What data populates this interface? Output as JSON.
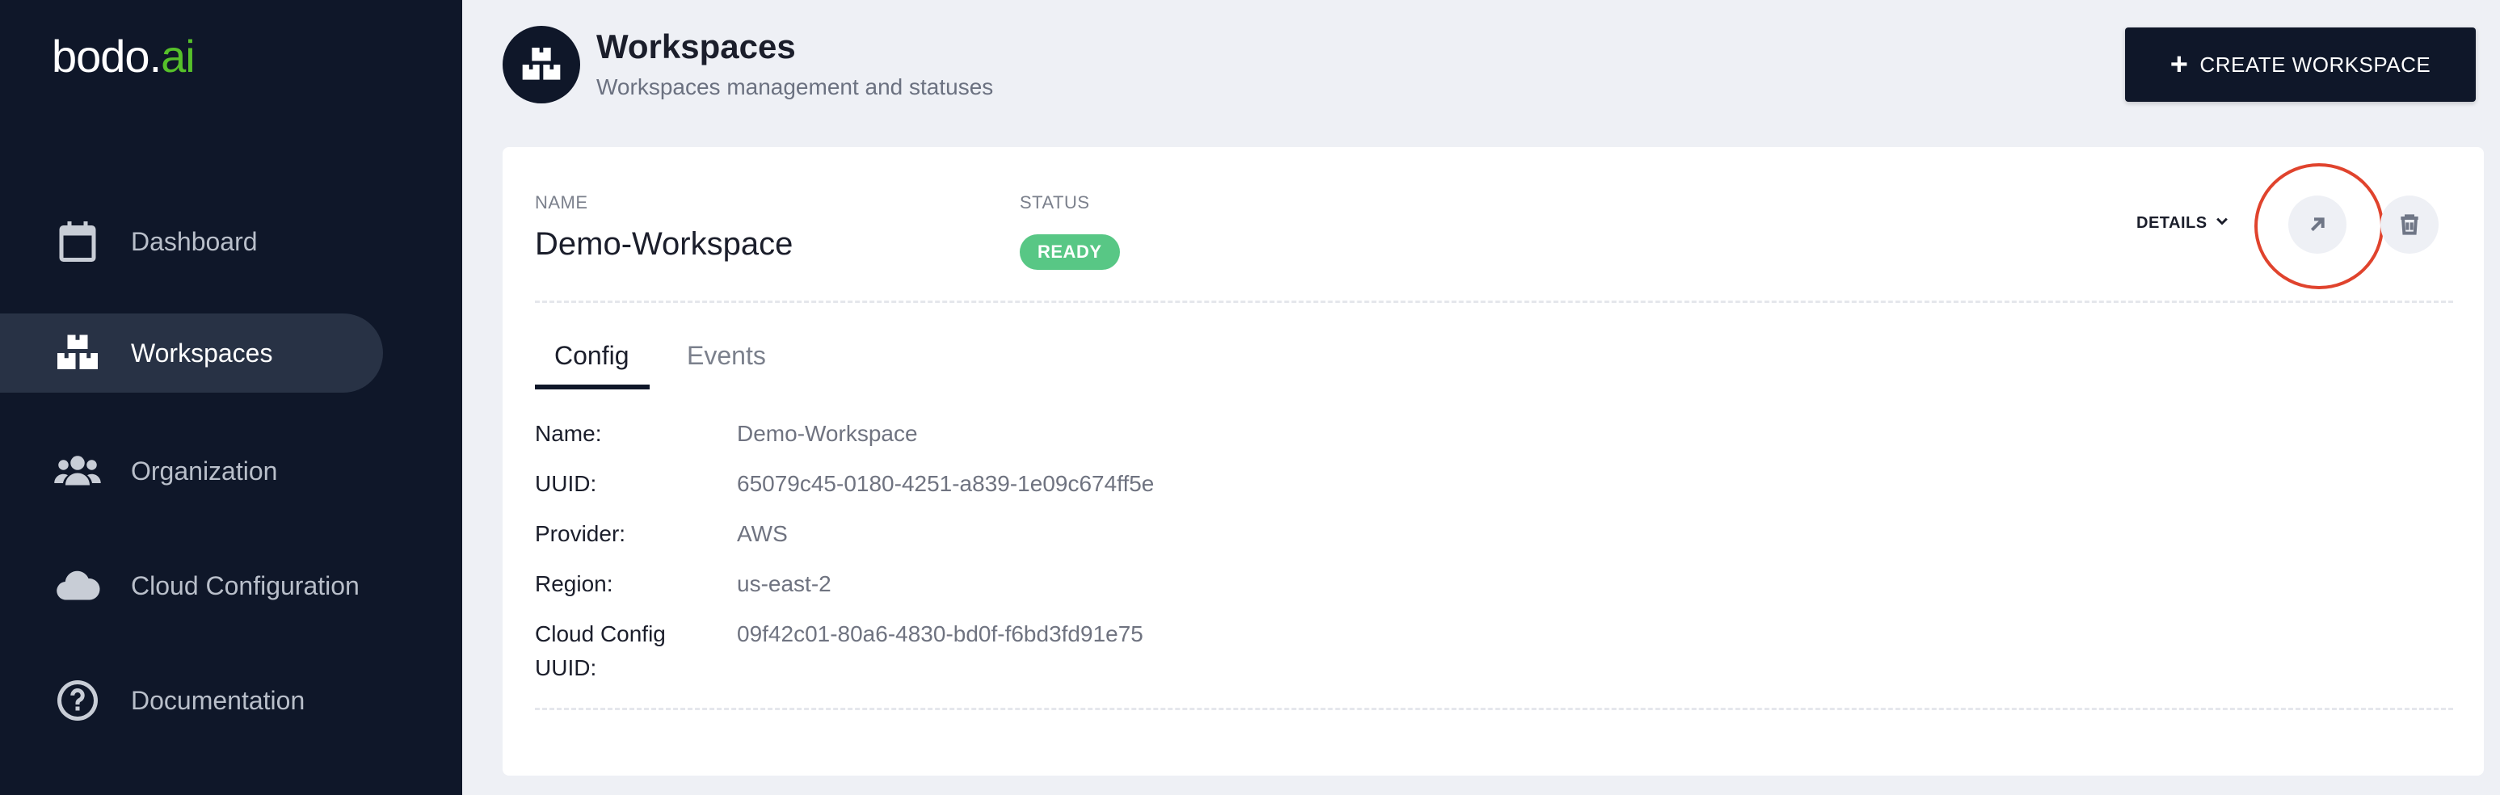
{
  "brand": {
    "logo_main": "bodo.",
    "logo_accent": "ai",
    "accent_color": "#56c02a"
  },
  "sidebar": {
    "items": [
      {
        "label": "Dashboard",
        "icon": "calendar-icon",
        "active": false
      },
      {
        "label": "Workspaces",
        "icon": "workspaces-icon",
        "active": true
      },
      {
        "label": "Organization",
        "icon": "users-icon",
        "active": false
      },
      {
        "label": "Cloud Configuration",
        "icon": "cloud-icon",
        "active": false
      },
      {
        "label": "Documentation",
        "icon": "help-circle-icon",
        "active": false
      }
    ]
  },
  "header": {
    "title": "Workspaces",
    "subtitle": "Workspaces management and statuses",
    "create_button": "CREATE WORKSPACE"
  },
  "workspace": {
    "name_label": "NAME",
    "name": "Demo-Workspace",
    "status_label": "STATUS",
    "status": "READY",
    "status_color": "#58c785",
    "details_label": "DETAILS",
    "tabs": [
      {
        "label": "Config",
        "active": true
      },
      {
        "label": "Events",
        "active": false
      }
    ],
    "config": [
      {
        "key": "Name:",
        "value": "Demo-Workspace"
      },
      {
        "key": "UUID:",
        "value": "65079c45-0180-4251-a839-1e09c674ff5e"
      },
      {
        "key": "Provider:",
        "value": "AWS"
      },
      {
        "key": "Region:",
        "value": "us-east-2"
      },
      {
        "key": "Cloud Config UUID:",
        "value": "09f42c01-80a6-4830-bd0f-f6bd3fd91e75"
      }
    ]
  }
}
